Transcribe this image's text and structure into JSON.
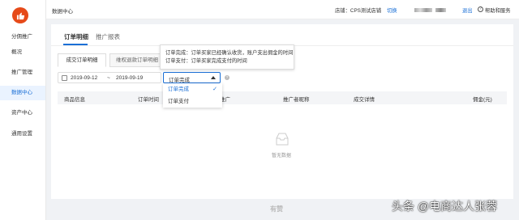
{
  "sidebar": {
    "items": [
      {
        "label": "分佣推广"
      },
      {
        "label": "概况"
      },
      {
        "label": "推广管理"
      },
      {
        "label": "数据中心"
      },
      {
        "label": "资产中心"
      },
      {
        "label": "通用设置"
      }
    ],
    "active_index": 3
  },
  "topbar": {
    "breadcrumb": "数据中心",
    "store_label": "店铺：CPS测试店铺",
    "switch_label": "切换",
    "logout_label": "退出",
    "help_label": "帮助和服务"
  },
  "main": {
    "tabs": [
      {
        "label": "订单明细"
      },
      {
        "label": "推广报表"
      }
    ],
    "sub_tabs": [
      {
        "label": "成交订单明细"
      },
      {
        "label": "维权退款订单明细"
      }
    ],
    "date_start": "2019-09-12",
    "date_sep": "~",
    "date_end": "2019-09-19",
    "select_value": "订单完成",
    "tooltip": {
      "line1": "订单完成：订单买家已经确认收货，账户支出佣金的时间",
      "line2": "订单支付：订单买家完成支付的时间"
    },
    "dropdown": {
      "options": [
        {
          "label": "订单完成"
        },
        {
          "label": "订单支付"
        }
      ],
      "check": "✓"
    },
    "columns": [
      {
        "label": "商品信息"
      },
      {
        "label": "订单时间"
      },
      {
        "label": "推广"
      },
      {
        "label": "推广者昵称"
      },
      {
        "label": "成交详情"
      },
      {
        "label": "佣金(元)"
      }
    ],
    "empty_text": "暂无数据"
  },
  "footer": {
    "logo": "有赞"
  },
  "watermark": "头条 @电商达人张蓉",
  "colors": {
    "accent": "#1a6fd6",
    "brand": "#e64a19"
  }
}
